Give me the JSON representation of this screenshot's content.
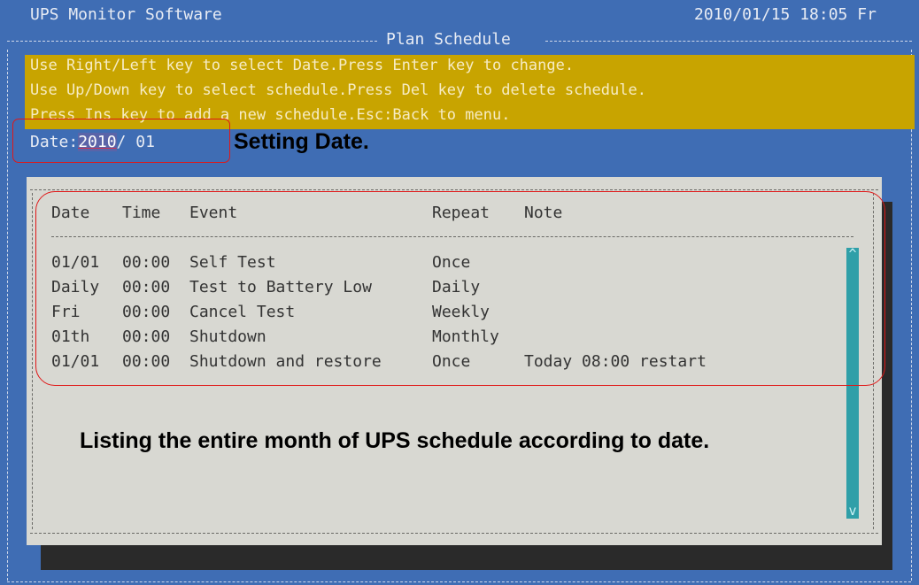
{
  "header": {
    "app_title": "UPS Monitor Software",
    "datetime": "2010/01/15 18:05 Fr",
    "screen_title": "Plan Schedule"
  },
  "help": {
    "lines": [
      "Use Right/Left key to select Date.Press Enter key to change.",
      "Use Up/Down key to select schedule.Press Del key to delete schedule.",
      "Press Ins key to add a new schedule.Esc:Back to menu."
    ]
  },
  "date_selector": {
    "label": "Date:",
    "year": "2010",
    "separator": "/",
    "month": "01"
  },
  "annotations": {
    "setting_date": "Setting Date.",
    "listing": "Listing the entire month of UPS schedule according to date."
  },
  "schedule_table": {
    "columns": [
      "Date",
      "Time",
      "Event",
      "Repeat",
      "Note"
    ],
    "rows": [
      {
        "date": "01/01",
        "time": "00:00",
        "event": "Self Test",
        "repeat": "Once",
        "note": ""
      },
      {
        "date": "Daily",
        "time": "00:00",
        "event": "Test to Battery Low",
        "repeat": "Daily",
        "note": ""
      },
      {
        "date": "Fri",
        "time": "00:00",
        "event": "Cancel Test",
        "repeat": "Weekly",
        "note": ""
      },
      {
        "date": "01th",
        "time": "00:00",
        "event": "Shutdown",
        "repeat": "Monthly",
        "note": ""
      },
      {
        "date": "01/01",
        "time": "00:00",
        "event": "Shutdown and restore",
        "repeat": "Once",
        "note": "Today 08:00 restart"
      }
    ]
  },
  "scrollbar": {
    "up_glyph": "^",
    "down_glyph": "v"
  },
  "colors": {
    "screen_bg": "#3f6db4",
    "help_bg": "#c8a400",
    "panel_bg": "#d8d8d2",
    "scrollbar": "#2f9fa8",
    "callout": "#e01818"
  }
}
